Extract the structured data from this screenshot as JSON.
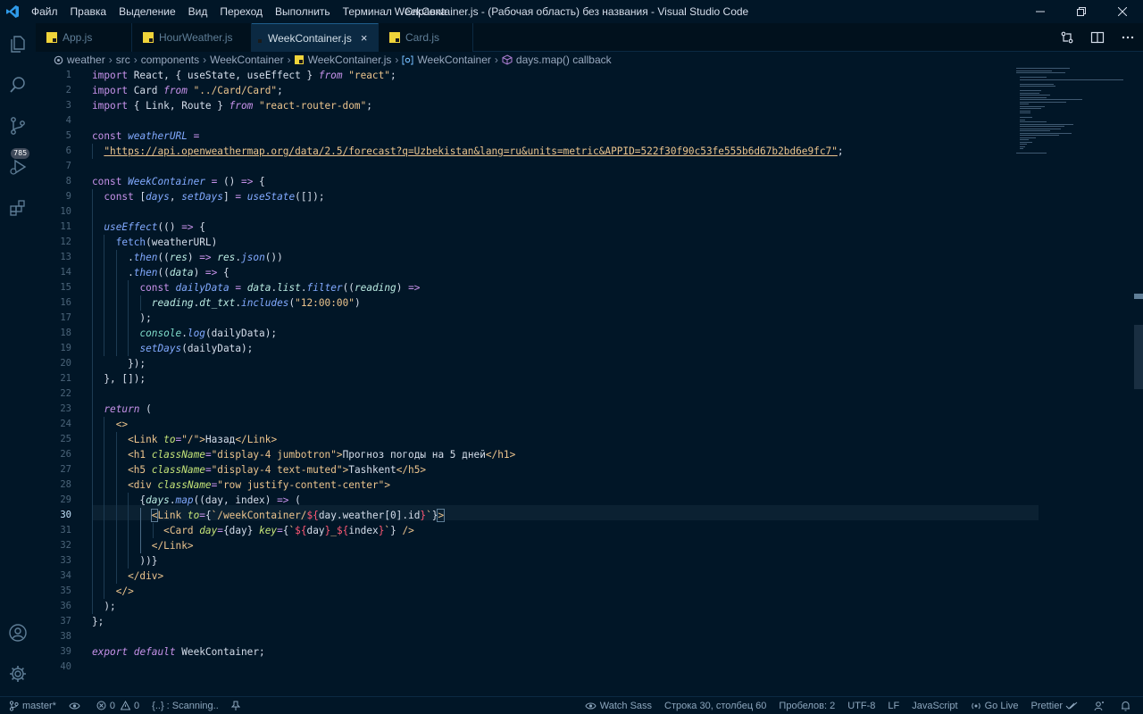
{
  "titlebar": {
    "menu": [
      "Файл",
      "Правка",
      "Выделение",
      "Вид",
      "Переход",
      "Выполнить",
      "Терминал",
      "Справка"
    ],
    "title": "WeekContainer.js - (Рабочая область) без названия - Visual Studio Code"
  },
  "activity": {
    "source_control_badge": "785"
  },
  "tabs": [
    {
      "label": "App.js",
      "active": false
    },
    {
      "label": "HourWeather.js",
      "active": false
    },
    {
      "label": "WeekContainer.js",
      "active": true,
      "close": "×"
    },
    {
      "label": "Card.js",
      "active": false
    }
  ],
  "breadcrumb": [
    "weather",
    "src",
    "components",
    "WeekContainer",
    "WeekContainer.js",
    "WeekContainer",
    "days.map() callback"
  ],
  "editor": {
    "line_numbers": [
      "1",
      "2",
      "3",
      "4",
      "5",
      "6",
      "7",
      "8",
      "9",
      "10",
      "11",
      "12",
      "13",
      "14",
      "15",
      "16",
      "17",
      "18",
      "19",
      "20",
      "21",
      "22",
      "23",
      "24",
      "25",
      "26",
      "27",
      "28",
      "29",
      "30",
      "31",
      "32",
      "33",
      "34",
      "35",
      "36",
      "37",
      "38",
      "39",
      "40"
    ],
    "current_line": 30,
    "code": {
      "l6_url": "\"https://api.openweathermap.org/data/2.5/forecast?q=Uzbekistan&lang=ru&units=metric&APPID=522f30f90c53fe555b6d67b2bd6e9fc7\"",
      "l16_str": "\"12:00:00\"",
      "l25_text": "Назад",
      "l26_class": "\"display-4 jumbotron\"",
      "l26_text": "Прогноз погоды на 5 дней",
      "l27_class": "\"display-4 text-muted\"",
      "l27_text": "Tashkent",
      "l28_class": "\"row justify-content-center\""
    }
  },
  "statusbar": {
    "branch": "master*",
    "errors": "0",
    "warnings": "0",
    "scanning": "{..} : Scanning..",
    "watch_sass": "Watch Sass",
    "position": "Строка 30, столбец 60",
    "spaces": "Пробелов: 2",
    "encoding": "UTF-8",
    "eol": "LF",
    "language": "JavaScript",
    "go_live": "Go Live",
    "prettier": "Prettier"
  },
  "colors": {
    "background": "#011627",
    "keyword": "#c792ea",
    "string": "#ecc48d",
    "function": "#82aaff",
    "jsx_attribute": "#c5e478"
  }
}
